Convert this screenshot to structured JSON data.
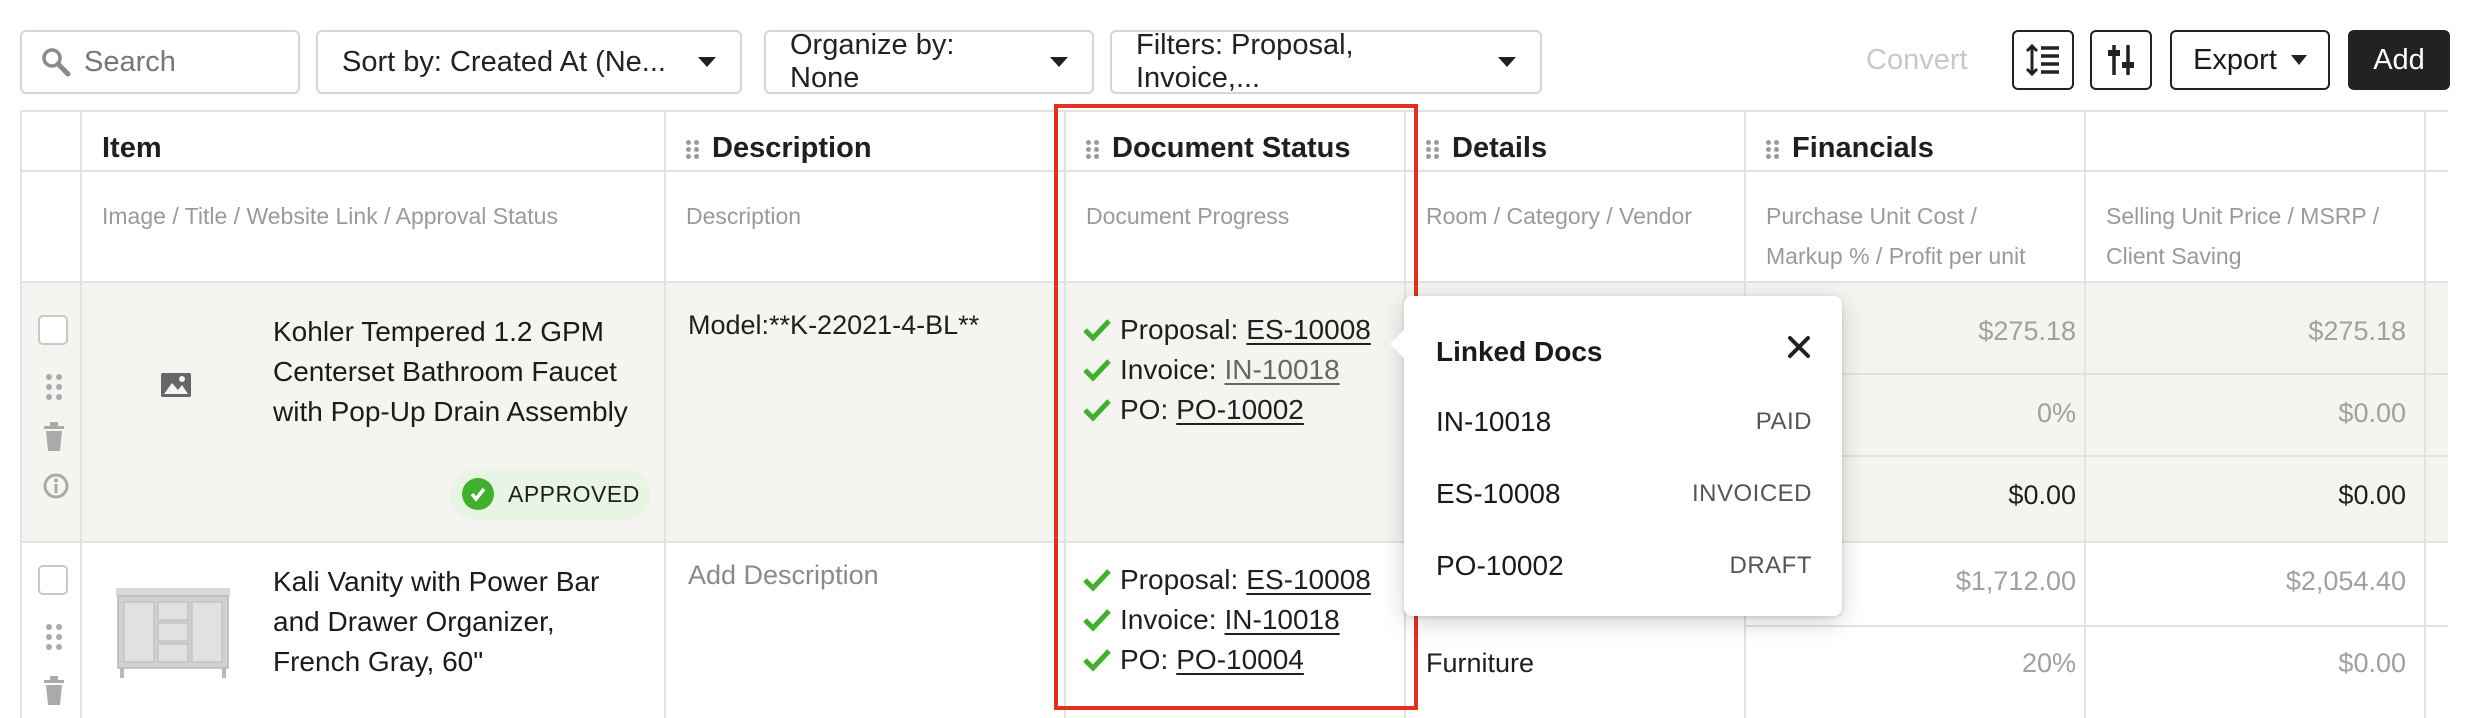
{
  "toolbar": {
    "search_placeholder": "Search",
    "sort_label": "Sort by: Created At (Ne...",
    "organize_label": "Organize by: None",
    "filters_label": "Filters: Proposal, Invoice,...",
    "convert_label": "Convert",
    "export_label": "Export",
    "add_label": "Add"
  },
  "columns": [
    {
      "title": "Item",
      "subtitle": "Image / Title / Website Link / Approval Status"
    },
    {
      "title": "Description",
      "subtitle": "Description"
    },
    {
      "title": "Document Status",
      "subtitle": "Document Progress"
    },
    {
      "title": "Details",
      "subtitle": "Room / Category / Vendor"
    },
    {
      "title": "Financials",
      "subtitle_a1": "Purchase Unit Cost /",
      "subtitle_a2": "Markup % / Profit per unit",
      "subtitle_b1": "Selling Unit Price / MSRP /",
      "subtitle_b2": "Client Saving"
    }
  ],
  "rows": [
    {
      "title_lines": [
        "Kohler Tempered 1.2 GPM",
        "Centerset Bathroom Faucet",
        "with Pop-Up Drain Assembly"
      ],
      "approval": "APPROVED",
      "description": "Model:**K-22021-4-BL**",
      "docs": [
        {
          "label": "Proposal:",
          "id": "ES-10008"
        },
        {
          "label": "Invoice:",
          "id": "IN-10018"
        },
        {
          "label": "PO:",
          "id": "PO-10002"
        }
      ],
      "fin_a": [
        "$275.18",
        "0%",
        "$0.00"
      ],
      "fin_b": [
        "$275.18",
        "$0.00",
        "$0.00"
      ]
    },
    {
      "title_lines": [
        "Kali Vanity with Power Bar",
        "and Drawer Organizer,",
        "French Gray, 60\""
      ],
      "description": "Add Description",
      "docs": [
        {
          "label": "Proposal:",
          "id": "ES-10008"
        },
        {
          "label": "Invoice:",
          "id": "IN-10018"
        },
        {
          "label": "PO:",
          "id": "PO-10004"
        }
      ],
      "detail": "Furniture",
      "fin_a": [
        "$1,712.00",
        "20%"
      ],
      "fin_b": [
        "$2,054.40",
        "$0.00"
      ]
    }
  ],
  "popover": {
    "title": "Linked Docs",
    "items": [
      {
        "id": "IN-10018",
        "status": "PAID"
      },
      {
        "id": "ES-10008",
        "status": "INVOICED"
      },
      {
        "id": "PO-10002",
        "status": "DRAFT"
      }
    ]
  },
  "colors": {
    "highlight": "#e2301e",
    "approved_green": "#3fb02b",
    "check_green": "#3fb02b"
  }
}
